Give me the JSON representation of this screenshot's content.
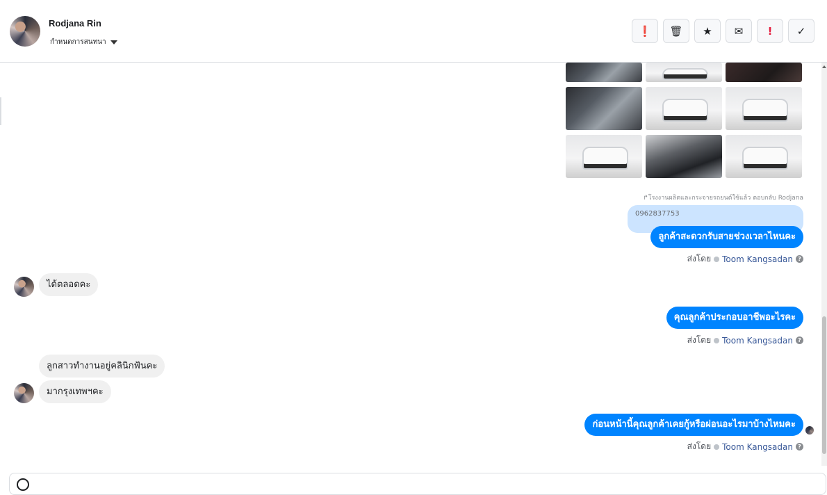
{
  "header": {
    "contact_name": "Rodjana Rin",
    "subline": "กำหนดการสนทนา",
    "actions": [
      {
        "name": "spam-icon",
        "glyph": "❗"
      },
      {
        "name": "trash-icon",
        "glyph": "🗑"
      },
      {
        "name": "star-icon",
        "glyph": "★"
      },
      {
        "name": "mail-icon",
        "glyph": "✉"
      },
      {
        "name": "important-icon",
        "glyph": "!"
      },
      {
        "name": "done-icon",
        "glyph": "✓"
      }
    ]
  },
  "reply": {
    "caption": "↱โรงงานผลิตและกระจายรถยนต์ใช้แล้ว ตอบกลับ Rodjana",
    "quoted_text": "0962837753"
  },
  "messages": {
    "out1": "ลูกค้าสะดวกรับสายช่วงเวลาไหนคะ",
    "in1": "ได้ตลอดคะ",
    "out2": "คุณลูกค้าประกอบอาชีพอะไรคะ",
    "in2": "ลูกสาวทำงานอยู่คลินิกฟันคะ",
    "in3": "มากรุงเทพฯคะ",
    "out3": "ก่อนหน้านี้คุณลูกค้าเคยกู้หรือผ่อนอะไรมาบ้างไหมคะ"
  },
  "sent_by": {
    "prefix": "ส่งโดย",
    "agent": "Toom Kangsadan",
    "help": "?"
  }
}
